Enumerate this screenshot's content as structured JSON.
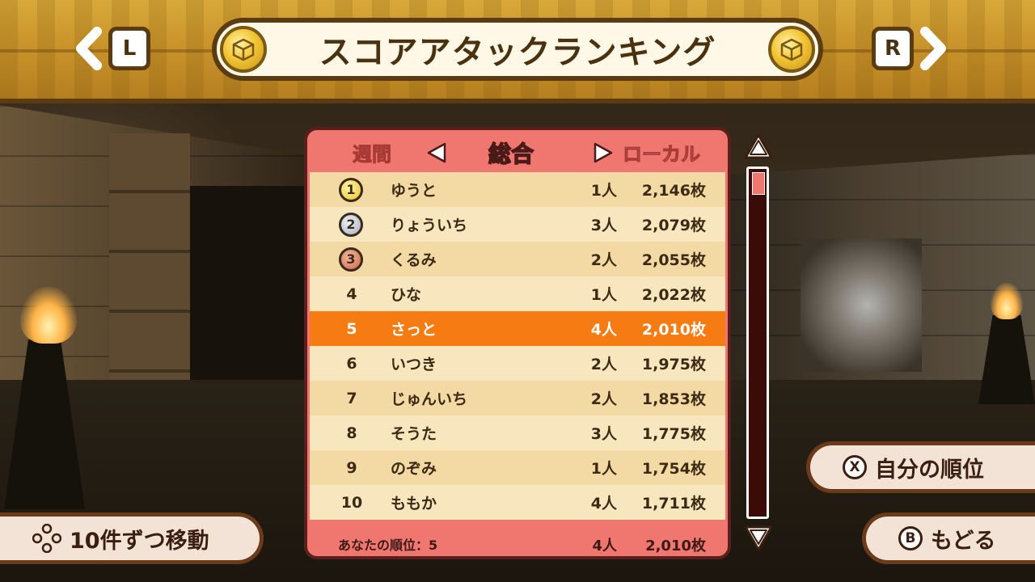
{
  "header": {
    "title": "スコアアタックランキング",
    "left_key": "L",
    "right_key": "R"
  },
  "tabs": {
    "weekly": "週間",
    "overall": "総合",
    "local": "ローカル",
    "selected": "総合"
  },
  "ranking": {
    "rows": [
      {
        "rank": "1",
        "name": "ゆうと",
        "players": "1人",
        "score": "2,146枚",
        "medal": "gold"
      },
      {
        "rank": "2",
        "name": "りょういち",
        "players": "3人",
        "score": "2,079枚",
        "medal": "silver"
      },
      {
        "rank": "3",
        "name": "くるみ",
        "players": "2人",
        "score": "2,055枚",
        "medal": "bronze"
      },
      {
        "rank": "4",
        "name": "ひな",
        "players": "1人",
        "score": "2,022枚"
      },
      {
        "rank": "5",
        "name": "さっと",
        "players": "4人",
        "score": "2,010枚",
        "highlight": true
      },
      {
        "rank": "6",
        "name": "いつき",
        "players": "2人",
        "score": "1,975枚"
      },
      {
        "rank": "7",
        "name": "じゅんいち",
        "players": "2人",
        "score": "1,853枚"
      },
      {
        "rank": "8",
        "name": "そうた",
        "players": "3人",
        "score": "1,775枚"
      },
      {
        "rank": "9",
        "name": "のぞみ",
        "players": "1人",
        "score": "1,754枚"
      },
      {
        "rank": "10",
        "name": "ももか",
        "players": "4人",
        "score": "1,711枚"
      }
    ],
    "footer": {
      "label": "あなたの順位：5",
      "players": "4人",
      "score": "2,010枚"
    }
  },
  "buttons": {
    "my_rank": {
      "key": "X",
      "label": "自分の順位"
    },
    "back": {
      "key": "B",
      "label": "もどる"
    },
    "move": {
      "label": "10件ずつ移動"
    }
  },
  "colors": {
    "panel": "#f07670",
    "highlight_row": "#f57b12",
    "header_gold": "#c8922a"
  }
}
